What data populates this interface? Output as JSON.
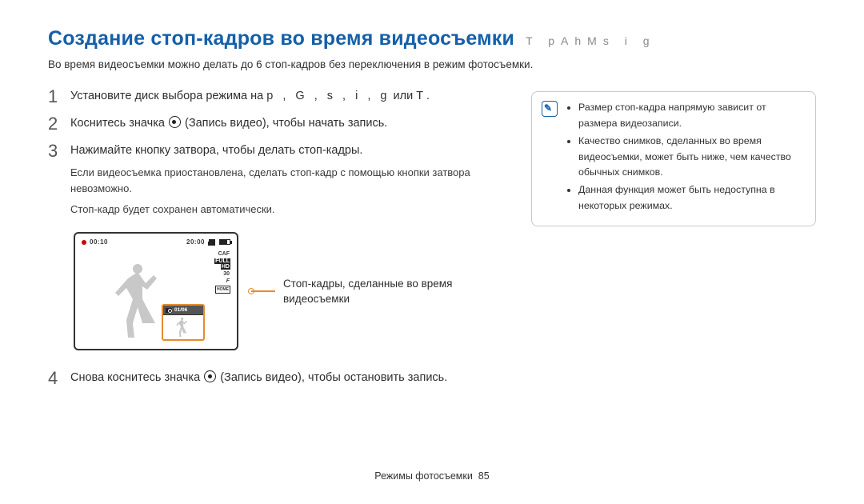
{
  "title": "Создание стоп-кадров во время видеосъемки",
  "mode_strip": "T   pAhMs  i   g",
  "intro": "Во время видеосъемки можно делать до 6 стоп-кадров без переключения в режим фотосъемки.",
  "steps": {
    "1": {
      "text_a": "Установите диск выбора режима на ",
      "modes": "p , G     , s   , i    , g",
      "text_b": " или T        .",
      "num": "1"
    },
    "2": {
      "text_a": "Коснитесь значка ",
      "text_b": " (Запись видео), чтобы начать запись.",
      "num": "2"
    },
    "3": {
      "text": "Нажимайте кнопку затвора, чтобы делать стоп-кадры.",
      "sub1": "Если видеосъемка приостановлена, сделать стоп-кадр с помощью кнопки затвора невозможно.",
      "sub2": "Стоп-кадр будет сохранен автоматически.",
      "num": "3"
    },
    "4": {
      "text_a": "Снова коснитесь значка ",
      "text_b": " (Запись видео), чтобы остановить запись.",
      "num": "4"
    }
  },
  "screen": {
    "time_elapsed": "00:10",
    "time_remaining": "20:00",
    "badges": {
      "caf": "CAF",
      "full": "FULL",
      "hd": "HD",
      "thirty": "30",
      "f": "F",
      "home": "HOME"
    },
    "thumb_counter": "01/06"
  },
  "caption": "Стоп-кадры, сделанные во время видеосъемки",
  "note": {
    "items": [
      "Размер стоп-кадра напрямую зависит от размера видеозаписи.",
      "Качество снимков, сделанных во время видеосъемки, может быть ниже, чем качество обычных снимков.",
      "Данная функция может быть недоступна в некоторых режимах."
    ]
  },
  "footer": {
    "label": "Режимы фотосъемки",
    "page": "85"
  }
}
